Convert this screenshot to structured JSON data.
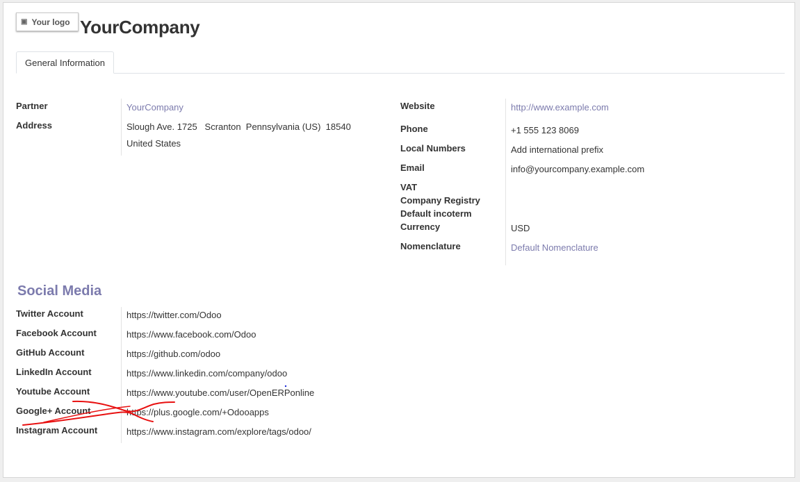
{
  "header": {
    "logo_text": "Your logo",
    "company_name": "YourCompany"
  },
  "tabs": [
    {
      "label": "General Information"
    }
  ],
  "left_fields": {
    "partner": {
      "label": "Partner",
      "value": "YourCompany"
    },
    "address": {
      "label": "Address",
      "line1": "Slough Ave. 1725   Scranton  Pennsylvania (US)  18540",
      "line2": "United States"
    }
  },
  "right_fields": {
    "website": {
      "label": "Website",
      "value": "http://www.example.com"
    },
    "phone": {
      "label": "Phone",
      "value": "+1 555 123 8069"
    },
    "local_numbers": {
      "label": "Local Numbers",
      "value": "Add international prefix"
    },
    "email": {
      "label": "Email",
      "value": "info@yourcompany.example.com"
    },
    "vat": {
      "label": "VAT",
      "value": ""
    },
    "company_registry": {
      "label": "Company Registry",
      "value": ""
    },
    "default_incoterm": {
      "label": "Default incoterm",
      "value": ""
    },
    "currency": {
      "label": "Currency",
      "value": "USD"
    },
    "nomenclature": {
      "label": "Nomenclature",
      "value": "Default Nomenclature"
    }
  },
  "social": {
    "title": "Social Media",
    "accounts": [
      {
        "label": "Twitter Account",
        "value": "https://twitter.com/Odoo"
      },
      {
        "label": "Facebook Account",
        "value": "https://www.facebook.com/Odoo"
      },
      {
        "label": "GitHub Account",
        "value": "https://github.com/odoo"
      },
      {
        "label": "LinkedIn Account",
        "value": "https://www.linkedin.com/company/odoo"
      },
      {
        "label": "Youtube Account",
        "value": "https://www.youtube.com/user/OpenERPonline"
      },
      {
        "label": "Google+ Account",
        "value": "https://plus.google.com/+Odooapps"
      },
      {
        "label": "Instagram Account",
        "value": "https://www.instagram.com/explore/tags/odoo/"
      }
    ]
  },
  "colors": {
    "accent": "#7c7bad",
    "annotation": "#e81010"
  },
  "icons": {
    "logo": "camera-icon"
  }
}
